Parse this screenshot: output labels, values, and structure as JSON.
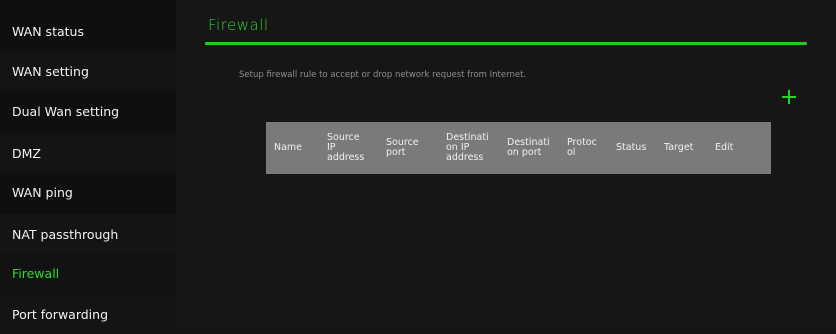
{
  "sidebar": {
    "items": [
      {
        "label": "WAN status"
      },
      {
        "label": "WAN setting"
      },
      {
        "label": "Dual Wan setting"
      },
      {
        "label": "DMZ"
      },
      {
        "label": "WAN ping"
      },
      {
        "label": "NAT passthrough"
      },
      {
        "label": "Firewall",
        "active": true
      },
      {
        "label": "Port forwarding"
      }
    ]
  },
  "main": {
    "title": "Firewall",
    "description": "Setup firewall rule to accept or drop network request from Internet.",
    "add_icon": "plus-icon",
    "table": {
      "columns": [
        "Name",
        "Source\nIP\naddress",
        "Source\nport",
        "Destinati\non IP\naddress",
        "Destinati\non port",
        "Protoc\nol",
        "Status",
        "Target",
        "Edit"
      ],
      "rows": []
    }
  },
  "colors": {
    "accent": "#2ddc2d",
    "background": "#161616",
    "sidebar_bg": "#0f0f0f",
    "table_header_bg": "#7a7a7a"
  }
}
